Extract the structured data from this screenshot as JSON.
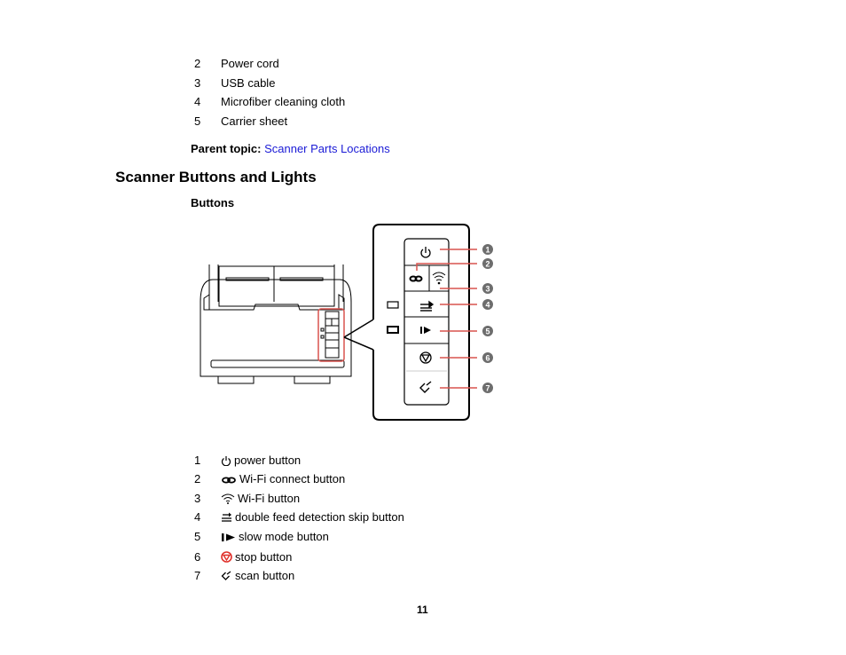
{
  "parts_list": [
    {
      "num": "2",
      "label": "Power cord"
    },
    {
      "num": "3",
      "label": "USB cable"
    },
    {
      "num": "4",
      "label": "Microfiber cleaning cloth"
    },
    {
      "num": "5",
      "label": "Carrier sheet"
    }
  ],
  "parent_topic": {
    "label": "Parent topic:",
    "link": "Scanner Parts Locations"
  },
  "section_title": "Scanner Buttons and Lights",
  "subsection_title": "Buttons",
  "figure": {
    "callouts": [
      "1",
      "2",
      "3",
      "4",
      "5",
      "6",
      "7"
    ],
    "callout_color": "#d9534f",
    "callout_badge_color": "#6d6d6d"
  },
  "buttons_list": [
    {
      "num": "1",
      "icon": "power-icon",
      "label": "power button"
    },
    {
      "num": "2",
      "icon": "wifi-connect-icon",
      "label": "Wi-Fi connect button"
    },
    {
      "num": "3",
      "icon": "wifi-icon",
      "label": "Wi-Fi button"
    },
    {
      "num": "4",
      "icon": "double-feed-skip-icon",
      "label": "double feed detection skip button"
    },
    {
      "num": "5",
      "icon": "slow-mode-icon",
      "label": "slow mode button"
    },
    {
      "num": "6",
      "icon": "stop-icon",
      "label": "stop button",
      "icon_color": "#e0302a"
    },
    {
      "num": "7",
      "icon": "scan-icon",
      "label": "scan button"
    }
  ],
  "page_number": "11"
}
